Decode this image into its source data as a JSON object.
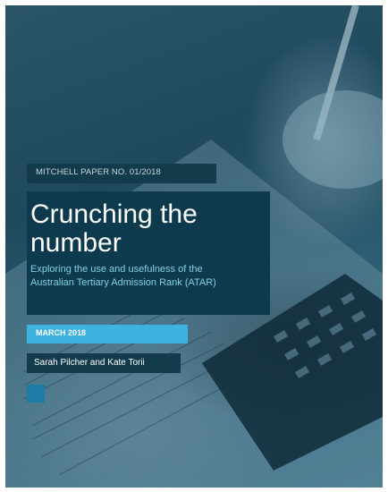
{
  "cover": {
    "series_label": "MITCHELL PAPER NO. 01/2018",
    "title_lines": [
      "Crunching the",
      "number"
    ],
    "subtitle_lines": [
      "Exploring the use and usefulness of the",
      "Australian Tertiary Admission Rank (ATAR)"
    ],
    "date": "MARCH 2018",
    "authors": "Sarah Pilcher and Kate Torii"
  },
  "colors": {
    "overlay": "#1f4a5e",
    "panel": "#0e3a4d",
    "date_band": "#3eb3e0",
    "accent_square": "#1e7aa6",
    "subtitle_text": "#7fd0e8"
  }
}
